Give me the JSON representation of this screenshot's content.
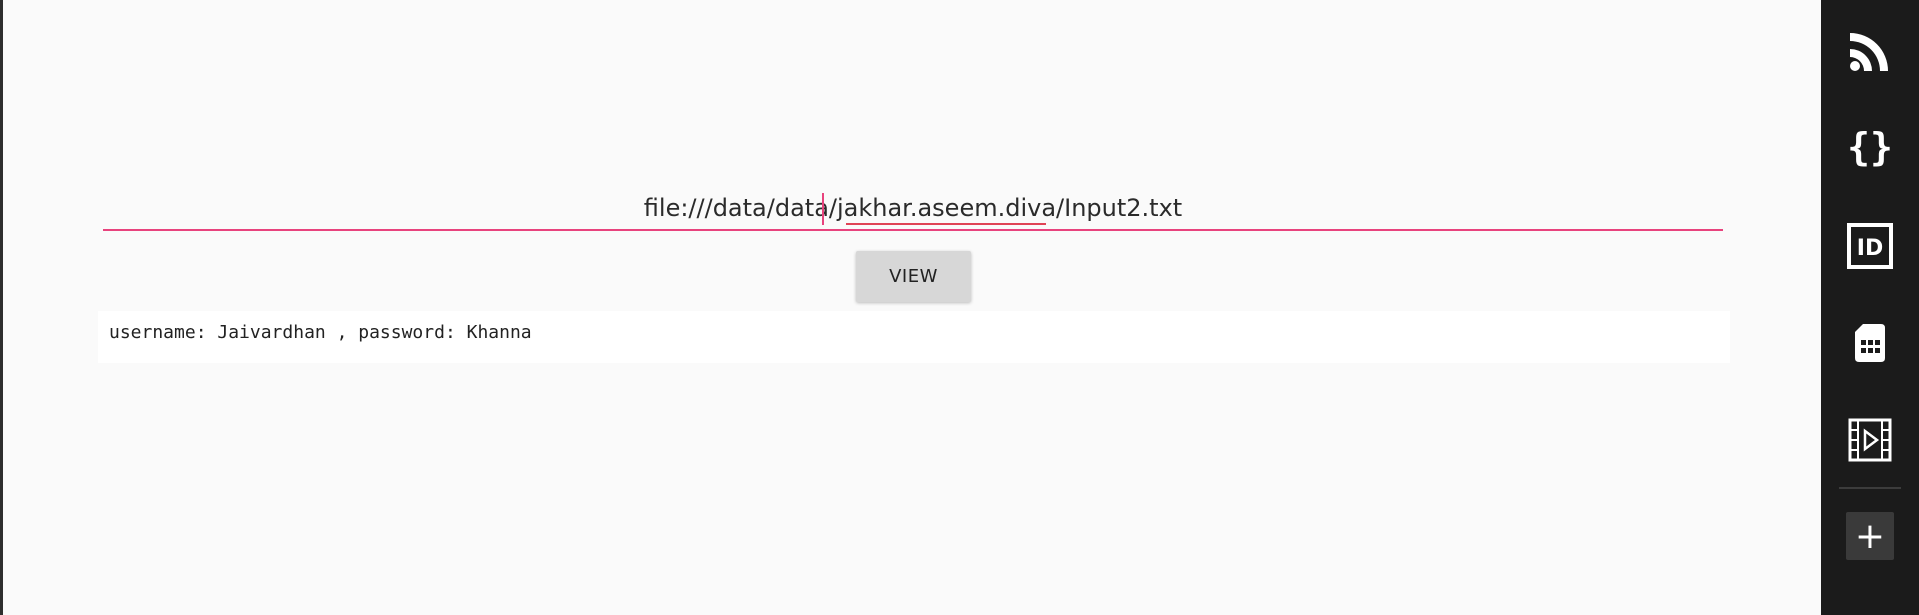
{
  "url_field": {
    "value": "file:///data/data/jakhar.aseem.diva/Input2.txt"
  },
  "view_button": {
    "label": "VIEW"
  },
  "output": {
    "text": "username: Jaivardhan , password: Khanna"
  },
  "sidebar": {
    "items": [
      {
        "icon": "rss-feed-icon"
      },
      {
        "icon": "code-braces-icon"
      },
      {
        "icon": "id-card-icon"
      },
      {
        "icon": "sim-card-icon"
      },
      {
        "icon": "movie-film-icon"
      }
    ],
    "add_label": "+"
  },
  "colors": {
    "accent": "#e8437d",
    "background": "#fafafa",
    "sidebar": "#1b1b1b",
    "button": "#d7d7d7"
  }
}
